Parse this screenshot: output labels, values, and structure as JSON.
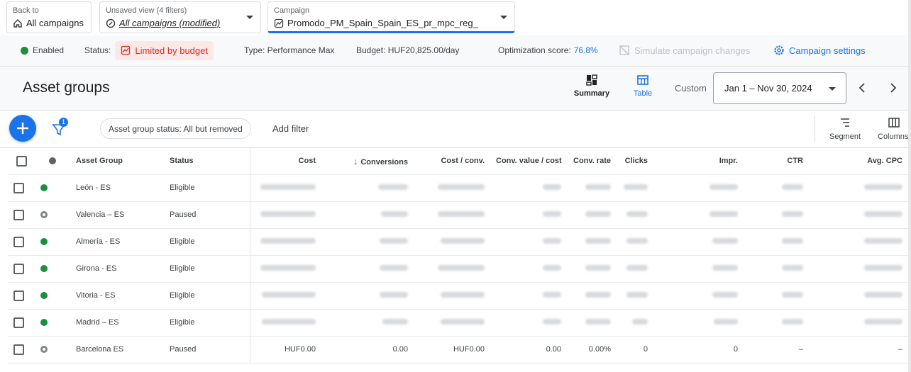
{
  "top": {
    "back_label": "Back to",
    "back_value": "All campaigns",
    "view_label": "Unsaved view (4 filters)",
    "view_value": "All campaigns (modified)",
    "campaign_label": "Campaign",
    "campaign_value": "Promodo_PM_Spain_Spain_ES_pr_mpc_reg_"
  },
  "status": {
    "enabled": "Enabled",
    "status_label": "Status:",
    "status_value": "Limited by budget",
    "type": "Type: Performance Max",
    "budget": "Budget: HUF20,825.00/day",
    "opt_label": "Optimization score:",
    "opt_value": "76.8%",
    "simulate": "Simulate campaign changes",
    "settings": "Campaign settings"
  },
  "header": {
    "title": "Asset groups",
    "summary": "Summary",
    "table": "Table",
    "custom": "Custom",
    "date_range": "Jan 1 – Nov 30, 2024"
  },
  "toolbar": {
    "filter_badge": "1",
    "status_chip": "Asset group status: All but removed",
    "add_filter": "Add filter",
    "segment": "Segment",
    "columns": "Columns"
  },
  "table": {
    "headers": {
      "asset_group": "Asset Group",
      "status": "Status",
      "cost": "Cost",
      "conversions": "Conversions",
      "cost_conv": "Cost / conv.",
      "conv_value_cost": "Conv. value / cost",
      "conv_rate": "Conv. rate",
      "clicks": "Clicks",
      "impr": "Impr.",
      "ctr": "CTR",
      "avg_cpc": "Avg. CPC"
    },
    "rows": [
      {
        "name": "León - ES",
        "status": "Eligible"
      },
      {
        "name": "Valencia – ES",
        "status": "Paused"
      },
      {
        "name": "Almería - ES",
        "status": "Eligible"
      },
      {
        "name": "Girona - ES",
        "status": "Eligible"
      },
      {
        "name": "Vitoria - ES",
        "status": "Eligible"
      },
      {
        "name": "Madrid – ES",
        "status": "Eligible"
      },
      {
        "name": "Barcelona ES",
        "status": "Paused",
        "cost": "HUF0.00",
        "conversions": "0.00",
        "cost_conv": "HUF0.00",
        "conv_value_cost": "0.00",
        "conv_rate": "0.00%",
        "clicks": "0",
        "impr": "0",
        "ctr": "–",
        "avg_cpc": "–"
      }
    ]
  },
  "colors": {
    "eligible": "#1e8e3e",
    "paused": "#80868b",
    "accent": "#1a73e8",
    "warning": "#d93025"
  }
}
